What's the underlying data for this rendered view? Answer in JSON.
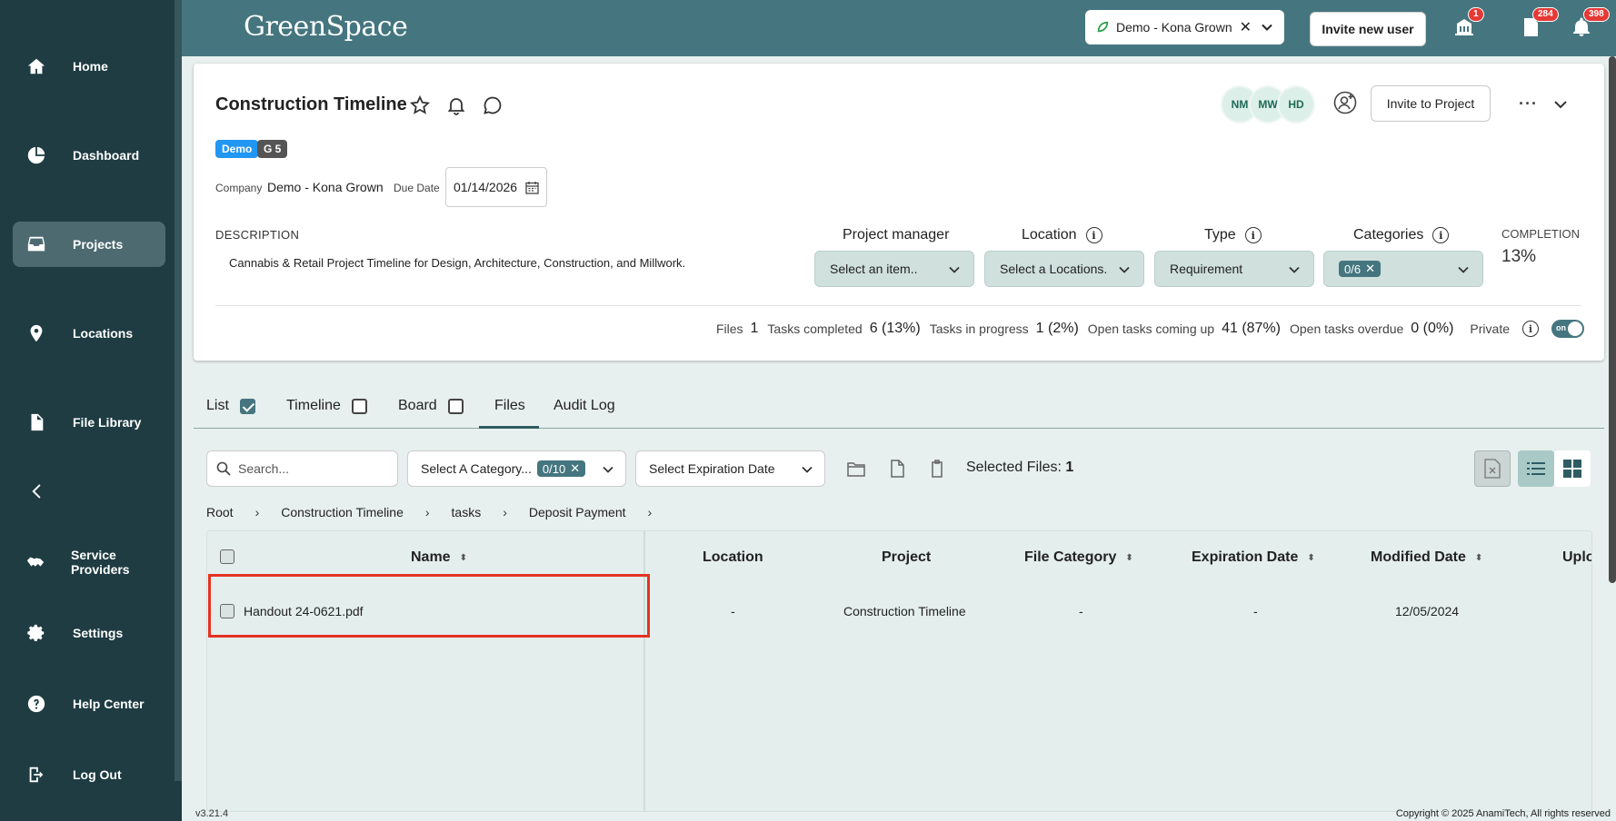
{
  "app": {
    "logo": "GreenSpace",
    "version": "v3.21.4",
    "copyright": "Copyright © 2025 AnamiTech, All rights reserved"
  },
  "sidebar": {
    "items": [
      {
        "label": "Home",
        "icon": "home-icon"
      },
      {
        "label": "Dashboard",
        "icon": "pie-chart-icon"
      },
      {
        "label": "Projects",
        "icon": "inbox-icon"
      },
      {
        "label": "Locations",
        "icon": "map-pin-icon"
      },
      {
        "label": "File Library",
        "icon": "file-icon"
      },
      {
        "label": "Service Providers",
        "icon": "handshake-icon"
      },
      {
        "label": "Settings",
        "icon": "gear-icon"
      },
      {
        "label": "Help Center",
        "icon": "help-icon"
      },
      {
        "label": "Log Out",
        "icon": "logout-icon"
      }
    ]
  },
  "topbar": {
    "company": "Demo - Kona Grown",
    "invite_label": "Invite new user",
    "badges": {
      "building": "1",
      "documents": "284",
      "notifications": "398"
    }
  },
  "project": {
    "title": "Construction Timeline",
    "tags": [
      "Demo",
      "G 5"
    ],
    "avatars": [
      "NM",
      "MW",
      "HD"
    ],
    "invite_label": "Invite to Project",
    "company_label": "Company",
    "company_value": "Demo - Kona Grown",
    "due_label": "Due Date",
    "due_value": "01/14/2026",
    "description_label": "DESCRIPTION",
    "description": "Cannabis & Retail Project Timeline for Design, Architecture, Construction, and Millwork.",
    "fields": {
      "manager": {
        "label": "Project manager",
        "value": "Select an item.."
      },
      "location": {
        "label": "Location",
        "value": "Select a Locations."
      },
      "type": {
        "label": "Type",
        "value": "Requirement"
      },
      "categories": {
        "label": "Categories",
        "value": "0/6"
      }
    },
    "completion_label": "COMPLETION",
    "completion_value": "13%",
    "stats": {
      "files_label": "Files",
      "files": "1",
      "completed_label": "Tasks completed",
      "completed": "6 (13%)",
      "progress_label": "Tasks in progress",
      "progress": "1 (2%)",
      "upcoming_label": "Open tasks coming up",
      "upcoming": "41 (87%)",
      "overdue_label": "Open tasks overdue",
      "overdue": "0 (0%)",
      "private_label": "Private",
      "toggle_label": "on"
    }
  },
  "tabs": {
    "list": "List",
    "timeline": "Timeline",
    "board": "Board",
    "files": "Files",
    "audit": "Audit Log"
  },
  "filters": {
    "search_placeholder": "Search...",
    "category_label": "Select A Category...",
    "category_chip": "0/10",
    "expiration_label": "Select Expiration Date",
    "selected_label": "Selected Files:",
    "selected_count": "1"
  },
  "breadcrumb": [
    "Root",
    "Construction Timeline",
    "tasks",
    "Deposit Payment"
  ],
  "table": {
    "headers": {
      "name": "Name",
      "location": "Location",
      "project": "Project",
      "category": "File Category",
      "expiration": "Expiration Date",
      "modified": "Modified Date",
      "uploaded": "Uplo"
    },
    "rows": [
      {
        "name": "Handout 24-0621.pdf",
        "location": "-",
        "project": "Construction Timeline",
        "category": "-",
        "expiration": "-",
        "modified": "12/05/2024"
      }
    ]
  },
  "colors": {
    "sidebar": "#1e3c42",
    "topbar": "#45767f",
    "highlight": "#e53222",
    "badge": "#e53935"
  }
}
